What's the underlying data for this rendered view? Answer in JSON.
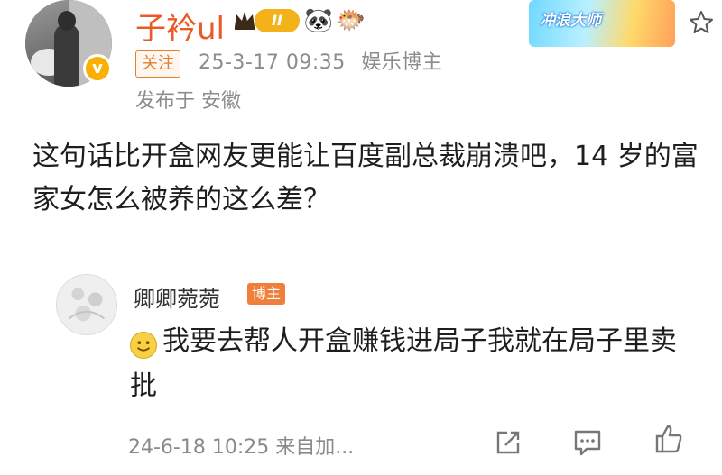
{
  "post": {
    "author": "子衿ul",
    "level_badge": "II",
    "emojis": [
      "🐼",
      "🐡"
    ],
    "follow_label": "关注",
    "timestamp": "25-3-17 09:35",
    "author_tag": "娱乐博主",
    "location": "发布于 安徽",
    "promo_label": "冲浪大师",
    "text": "这句话比开盒网友更能让百度副总裁崩溃吧，14 岁的富家女怎么被养的这么差？"
  },
  "reply": {
    "author": "卿卿菀菀",
    "poster_tag": "博主",
    "text": "我要去帮人开盒赚钱进局子我就在局子里卖批",
    "meta": "24-6-18 10:25 来自加..."
  },
  "colors": {
    "username": "#ea5a26",
    "follow_tag": "#e0812f",
    "poster_tag": "#f07f3c",
    "meta_text": "#8c8c8c"
  }
}
